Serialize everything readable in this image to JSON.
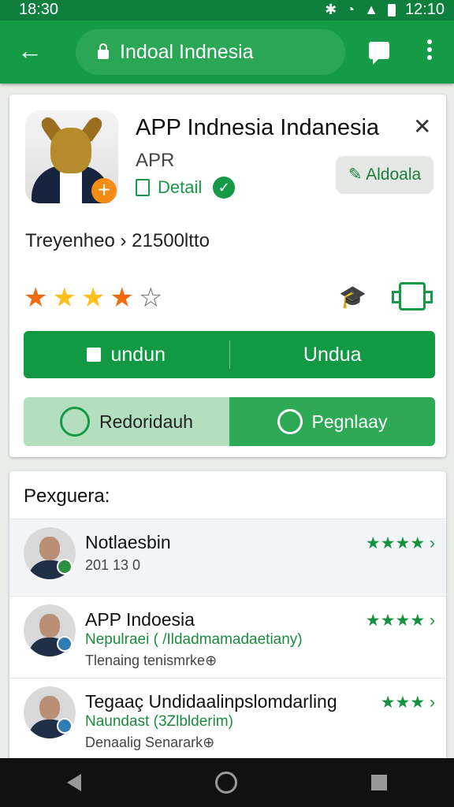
{
  "status_bar": {
    "time_left": "18:30",
    "time_right": "12:10"
  },
  "toolbar": {
    "url": "Indoal Indnesia"
  },
  "app": {
    "title": "APP Indnesia Indanesia",
    "subtitle": "APR",
    "detail_label": "Detail",
    "add_label": "Aldoala",
    "ranking_text": "Treyenheo › 21500ltto",
    "rating_stars": 4,
    "primary_left": "undun",
    "primary_right": "Undua",
    "secondary_left": "Redoridauh",
    "secondary_right": "Pegnlaay"
  },
  "reviews_section": {
    "title": "Pexguera:",
    "items": [
      {
        "name": "Notlaesbin",
        "line1": "201 13 0",
        "line2": "",
        "stars": "★★★★ ›"
      },
      {
        "name": "APP Indoesia",
        "line1": "Nepulraei ( /Ildadmamadaetiany)",
        "line2": "Tlenaing tenismrke⊕",
        "stars": "★★★★ ›"
      },
      {
        "name": "Tegaaç Undidaalinpslomdarling",
        "line1": "Naundast (3Zlblderim)",
        "line2": "Denaalig Senarark⊕",
        "stars": "★★★ ›"
      }
    ]
  }
}
